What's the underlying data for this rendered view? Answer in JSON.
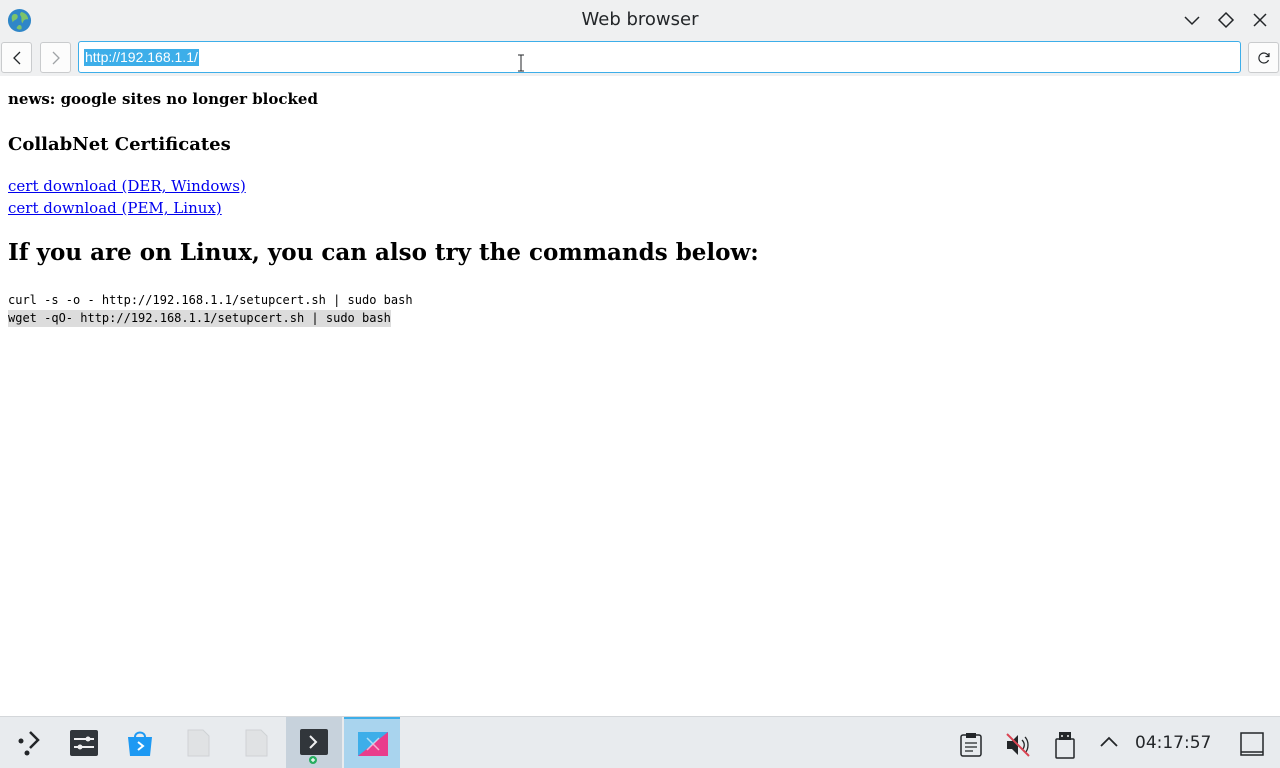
{
  "window": {
    "title": "Web browser"
  },
  "navbar": {
    "url": "http://192.168.1.1/"
  },
  "page": {
    "news": "news: google sites no longer blocked",
    "section_heading": "CollabNet Certificates",
    "links": [
      "cert download (DER, Windows)",
      "cert download (PEM, Linux)"
    ],
    "linux_heading": "If you are on Linux, you can also try the commands below:",
    "commands": [
      "curl -s -o - http://192.168.1.1/setupcert.sh | sudo bash",
      "wget -qO- http://192.168.1.1/setupcert.sh | sudo bash"
    ]
  },
  "taskbar": {
    "clock": "04:17:57",
    "apps": [
      "application-launcher-icon",
      "settings-manager-icon",
      "software-store-icon",
      "file-icon",
      "file-icon",
      "terminal-icon",
      "web-browser-icon"
    ]
  },
  "colors": {
    "accent": "#3daee9",
    "link": "#0000ee"
  }
}
